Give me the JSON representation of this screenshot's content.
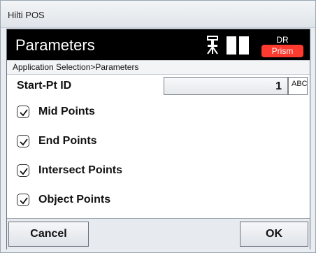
{
  "window": {
    "title": "Hilti POS"
  },
  "header": {
    "title": "Parameters",
    "dr_label": "DR",
    "prism_label": "Prism"
  },
  "breadcrumb": "Application Selection>Parameters",
  "start_point": {
    "label": "Start-Pt ID",
    "value": "1",
    "abc_label": "ABC"
  },
  "options": [
    {
      "label": "Mid Points",
      "checked": true
    },
    {
      "label": "End Points",
      "checked": true
    },
    {
      "label": "Intersect Points",
      "checked": true
    },
    {
      "label": "Object Points",
      "checked": true
    }
  ],
  "footer": {
    "cancel_label": "Cancel",
    "ok_label": "OK"
  },
  "colors": {
    "header_bg": "#000000",
    "prism_badge": "#ff3b30"
  }
}
